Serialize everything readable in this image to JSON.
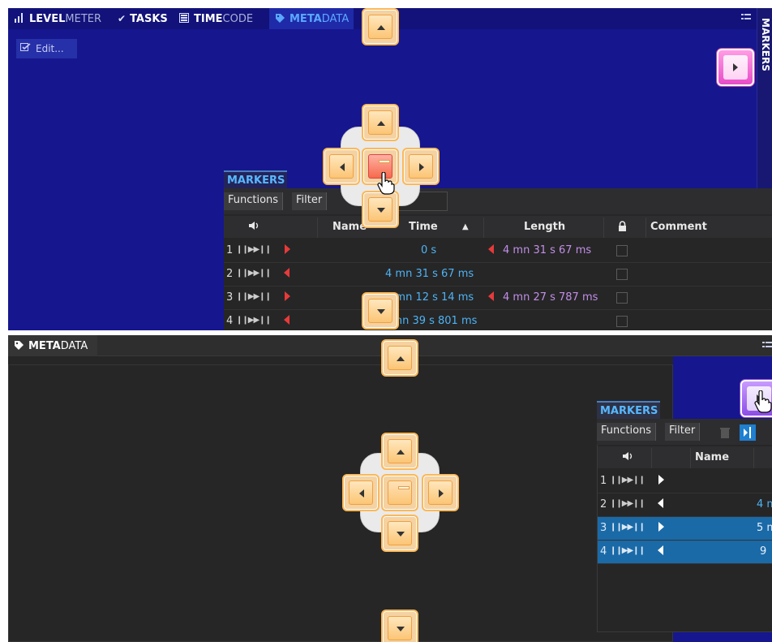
{
  "panel1": {
    "tabs": [
      {
        "bold": "LEVEL",
        "light": "METER",
        "icon": "levelmeter-icon",
        "active": false
      },
      {
        "bold": "TASKS",
        "light": "",
        "icon": "checkmark-icon",
        "active": false
      },
      {
        "bold": "TIME",
        "light": "CODE",
        "icon": "timecode-icon",
        "active": false
      },
      {
        "bold": "META",
        "light": "DATA",
        "icon": "tag-icon",
        "active": true
      }
    ],
    "side_tab_label": "MARKERS",
    "edit_label": "Edit...",
    "markers": {
      "title": "MARKERS",
      "toolbar": {
        "functions": "Functions",
        "filter": "Filter"
      },
      "columns": {
        "name": "Name",
        "time": "Time",
        "length": "Length",
        "comment": "Comment"
      },
      "rows": [
        {
          "num": "1",
          "time": "0 s",
          "length": "4 mn 31 s 67 ms",
          "direction": "start"
        },
        {
          "num": "2",
          "time": "4 mn 31 s 67 ms",
          "length": "",
          "direction": "end"
        },
        {
          "num": "3",
          "time": "5 mn 12 s 14 ms",
          "length": "4 mn 27 s 787 ms",
          "direction": "start"
        },
        {
          "num": "4",
          "time": "9 mn 39 s 801 ms",
          "length": "",
          "direction": "end"
        }
      ]
    }
  },
  "panel2": {
    "tab": {
      "bold": "META",
      "light": "DATA",
      "icon": "tag-icon"
    },
    "markers": {
      "title": "MARKERS",
      "toolbar": {
        "functions": "Functions",
        "filter": "Filter"
      },
      "columns": {
        "name": "Name"
      },
      "rows": [
        {
          "num": "1",
          "time": "",
          "direction": "start",
          "selected": false
        },
        {
          "num": "2",
          "time": "4 m",
          "direction": "end",
          "selected": false
        },
        {
          "num": "3",
          "time": "5 m",
          "direction": "start",
          "selected": true
        },
        {
          "num": "4",
          "time": "9",
          "direction": "end",
          "selected": true
        }
      ]
    }
  },
  "colors": {
    "panel_blue": "#16168f",
    "dark_bg": "#262626",
    "time_blue": "#4eb3f5",
    "length_purple": "#c28fe8",
    "marker_red": "#e83a3a",
    "guide_orange": "#fbb858",
    "selection_blue": "#1a6aa8"
  },
  "icons": {
    "speaker": "speaker-icon",
    "lock": "lock-icon",
    "play_range": "play-range-icon",
    "menu": "panel-menu-icon"
  }
}
